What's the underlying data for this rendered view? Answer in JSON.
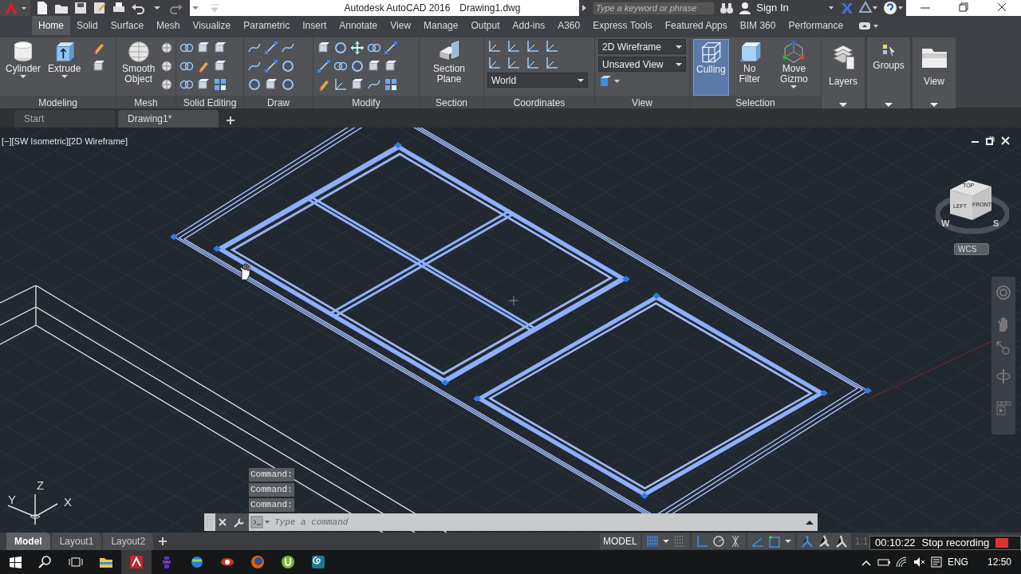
{
  "title_bar": {
    "app_title": "Autodesk AutoCAD 2016",
    "file_name": "Drawing1.dwg",
    "search": {
      "placeholder": "Type a keyword or phrase"
    },
    "sign_in": "Sign In"
  },
  "ribbon_tabs": [
    {
      "label": "Home",
      "selected": true
    },
    {
      "label": "Solid",
      "selected": false
    },
    {
      "label": "Surface",
      "selected": false
    },
    {
      "label": "Mesh",
      "selected": false
    },
    {
      "label": "Visualize",
      "selected": false
    },
    {
      "label": "Parametric",
      "selected": false
    },
    {
      "label": "Insert",
      "selected": false
    },
    {
      "label": "Annotate",
      "selected": false
    },
    {
      "label": "View",
      "selected": false
    },
    {
      "label": "Manage",
      "selected": false
    },
    {
      "label": "Output",
      "selected": false
    },
    {
      "label": "Add-ins",
      "selected": false
    },
    {
      "label": "A360",
      "selected": false
    },
    {
      "label": "Express Tools",
      "selected": false
    },
    {
      "label": "Featured Apps",
      "selected": false
    },
    {
      "label": "BIM 360",
      "selected": false
    },
    {
      "label": "Performance",
      "selected": false
    }
  ],
  "ribbon_panels": [
    {
      "kind": "tools",
      "title": "Modeling",
      "large_buttons": [
        {
          "label": "Cylinder",
          "kind": "cylinder",
          "selected": false
        },
        {
          "label": "Extrude",
          "kind": "extrude",
          "selected": false
        }
      ]
    },
    {
      "kind": "tools",
      "title": "Mesh",
      "large_buttons": [
        {
          "label": "Smooth Object",
          "kind": "sphere",
          "selected": false
        }
      ]
    },
    {
      "kind": "tools",
      "title": "Solid Editing"
    },
    {
      "kind": "tools",
      "title": "Draw"
    },
    {
      "kind": "tools",
      "title": "Modify"
    },
    {
      "kind": "tools",
      "title": "Section",
      "large_buttons": [
        {
          "label": "Section Plane",
          "kind": "plane",
          "selected": false
        }
      ]
    },
    {
      "kind": "tools",
      "title": "Coordinates",
      "dropdowns": [
        "World"
      ]
    },
    {
      "kind": "tools",
      "title": "View",
      "dropdowns": [
        "2D Wireframe",
        "Unsaved View"
      ]
    },
    {
      "kind": "tools",
      "title": "Selection",
      "large_buttons": [
        {
          "label": "Culling",
          "kind": "culling",
          "selected": true
        },
        {
          "label": "No Filter",
          "kind": "cube",
          "selected": false
        },
        {
          "label": "Move Gizmo",
          "kind": "gizmo",
          "selected": false
        }
      ]
    },
    {
      "kind": "collapsed",
      "title": "Layers"
    },
    {
      "kind": "collapsed",
      "title": "Groups"
    },
    {
      "kind": "collapsed",
      "title": "View"
    }
  ],
  "document_tabs": [
    {
      "label": "Start",
      "selected": false
    },
    {
      "label": "Drawing1*",
      "selected": true
    }
  ],
  "viewport": {
    "label": "[−][SW Isometric][2D Wireframe]",
    "viewcube_faces": [
      "TOP",
      "LEFT",
      "FRONT"
    ],
    "compass": [
      "W",
      "S"
    ],
    "coordinate_system": "WCS",
    "ucs_axes": [
      "Z",
      "Y",
      "X"
    ]
  },
  "command_history": [
    "Command:",
    "Command:",
    "Command:"
  ],
  "command_line": {
    "placeholder": "Type a command"
  },
  "layout_tabs": [
    {
      "label": "Model",
      "selected": true
    },
    {
      "label": "Layout1",
      "selected": false
    },
    {
      "label": "Layout2",
      "selected": false
    }
  ],
  "status_bar": {
    "space": "MODEL",
    "scale": "1:1",
    "toggles": [
      {
        "kind": "grid",
        "on": true
      },
      {
        "kind": "snap",
        "on": false
      },
      {
        "kind": "ortho",
        "on": true
      },
      {
        "kind": "polar",
        "on": false
      },
      {
        "kind": "isodraft",
        "on": false
      },
      {
        "kind": "tracking",
        "on": true
      },
      {
        "kind": "osnap",
        "on": true
      },
      {
        "kind": "annotation",
        "on": true
      },
      {
        "kind": "autoscale",
        "on": false
      },
      {
        "kind": "annoscale",
        "on": false
      }
    ]
  },
  "recorder": {
    "time": "00:10:22",
    "action": "Stop recording"
  },
  "taskbar": {
    "language": "ENG",
    "clock": "12:50"
  }
}
